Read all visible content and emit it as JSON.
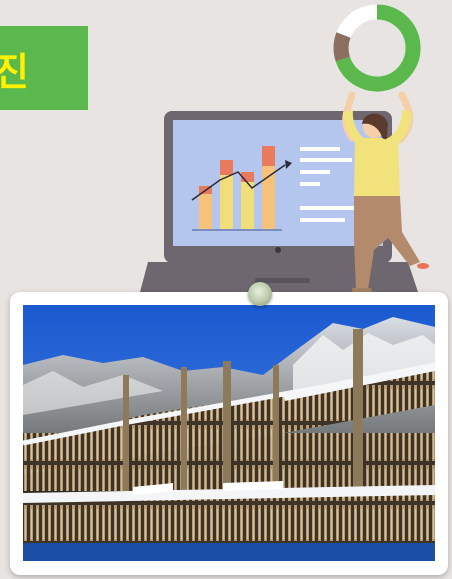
{
  "badge": {
    "text": "진",
    "bg_color": "#5bb84c",
    "text_color": "#fff100"
  },
  "illustration": {
    "donut": {
      "green_fraction": 0.72,
      "brown_fraction": 0.14,
      "white_fraction": 0.14
    },
    "bar_chart": {
      "values": [
        0.35,
        0.55,
        0.5,
        0.72
      ],
      "colors": [
        "#f6c27a",
        "#f2de78",
        "#e97a5c"
      ]
    }
  },
  "photo": {
    "subject": "snow-covered-drying-racks"
  }
}
